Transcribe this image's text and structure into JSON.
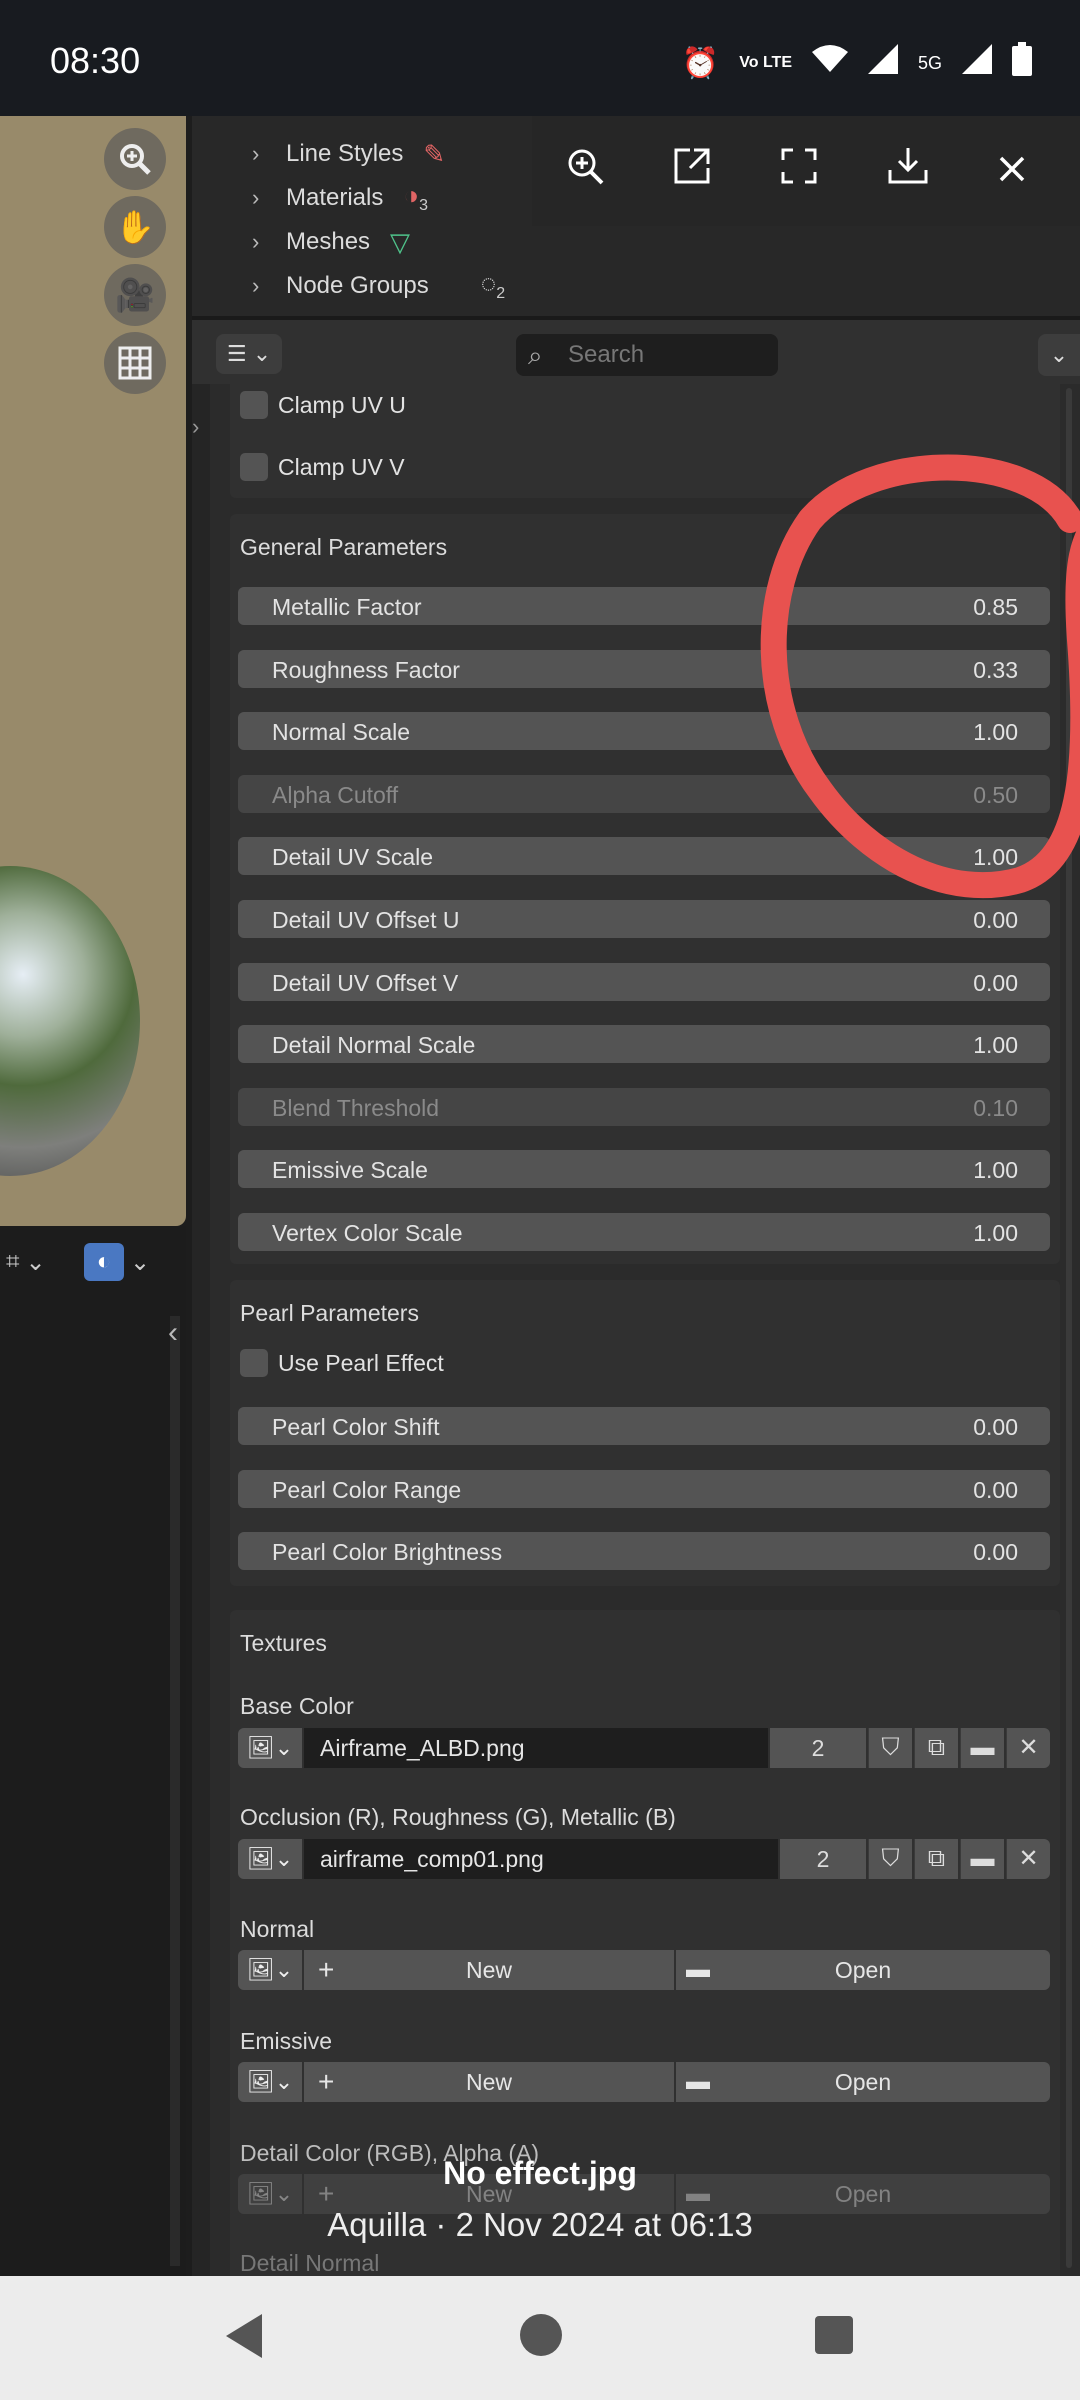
{
  "status_bar": {
    "time": "08:30",
    "icons": [
      "alarm-icon",
      "volte-icon",
      "wifi-icon",
      "signal-icon",
      "battery-icon"
    ],
    "volte_label": "Vo LTE",
    "network_label": "5G"
  },
  "viewport": {
    "tools": [
      "zoom-icon",
      "hand-icon",
      "camera-icon",
      "grid-icon"
    ]
  },
  "outliner": {
    "rows": [
      {
        "label": "Line Styles",
        "icon": "brush-icon",
        "count": ""
      },
      {
        "label": "Materials",
        "icon": "material-icon",
        "count": "3"
      },
      {
        "label": "Meshes",
        "icon": "mesh-icon",
        "count": ""
      },
      {
        "label": "Node Groups",
        "icon": "nodegroup-icon",
        "count": "2"
      }
    ]
  },
  "viewer_toolbar": [
    "zoom-in-icon",
    "open-external-icon",
    "fullscreen-icon",
    "download-icon",
    "close-icon"
  ],
  "properties": {
    "search_placeholder": "Search",
    "clamp_uv_u": "Clamp UV U",
    "clamp_uv_v": "Clamp UV V",
    "general": {
      "title": "General Parameters",
      "fields": [
        {
          "label": "Metallic Factor",
          "value": "0.85",
          "disabled": false
        },
        {
          "label": "Roughness Factor",
          "value": "0.33",
          "disabled": false
        },
        {
          "label": "Normal Scale",
          "value": "1.00",
          "disabled": false
        },
        {
          "label": "Alpha Cutoff",
          "value": "0.50",
          "disabled": true
        },
        {
          "label": "Detail UV Scale",
          "value": "1.00",
          "disabled": false
        },
        {
          "label": "Detail UV Offset U",
          "value": "0.00",
          "disabled": false
        },
        {
          "label": "Detail UV Offset V",
          "value": "0.00",
          "disabled": false
        },
        {
          "label": "Detail Normal Scale",
          "value": "1.00",
          "disabled": false
        },
        {
          "label": "Blend Threshold",
          "value": "0.10",
          "disabled": true
        },
        {
          "label": "Emissive Scale",
          "value": "1.00",
          "disabled": false
        },
        {
          "label": "Vertex Color Scale",
          "value": "1.00",
          "disabled": false
        }
      ]
    },
    "pearl": {
      "title": "Pearl Parameters",
      "use_pearl": "Use Pearl Effect",
      "fields": [
        {
          "label": "Pearl Color Shift",
          "value": "0.00"
        },
        {
          "label": "Pearl Color Range",
          "value": "0.00"
        },
        {
          "label": "Pearl Color Brightness",
          "value": "0.00"
        }
      ]
    },
    "textures": {
      "title": "Textures",
      "base_color": {
        "label": "Base Color",
        "file": "Airframe_ALBD.png",
        "users": "2"
      },
      "orm": {
        "label": "Occlusion (R), Roughness (G), Metallic (B)",
        "file": "airframe_comp01.png",
        "users": "2"
      },
      "normal": {
        "label": "Normal",
        "new": "New",
        "open": "Open"
      },
      "emissive": {
        "label": "Emissive",
        "new": "New",
        "open": "Open"
      },
      "detail_color": {
        "label": "Detail Color (RGB), Alpha (A)",
        "new": "New",
        "open": "Open"
      },
      "detail_normal": {
        "label": "Detail Normal"
      }
    }
  },
  "annotation_color": "#e8524f",
  "caption": {
    "title": "No effect.jpg",
    "subtitle": "Aquilla · 2 Nov 2024 at 06:13"
  }
}
